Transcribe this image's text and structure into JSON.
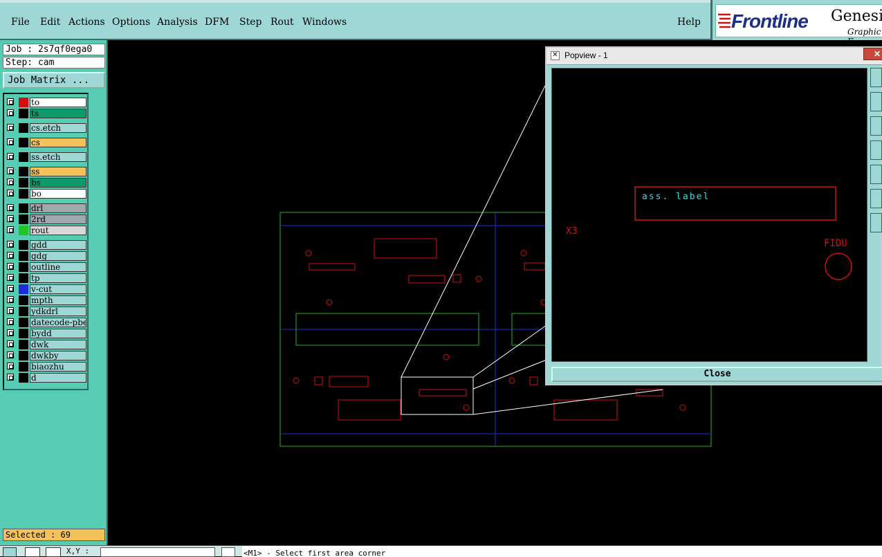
{
  "menubar": {
    "items": [
      {
        "label": "File"
      },
      {
        "label": "Edit"
      },
      {
        "label": "Actions"
      },
      {
        "label": "Options"
      },
      {
        "label": "Analysis"
      },
      {
        "label": "DFM"
      },
      {
        "label": "Step"
      },
      {
        "label": "Rout"
      },
      {
        "label": "Windows"
      }
    ],
    "help": "Help"
  },
  "brand": {
    "logo": "Frontline",
    "product": "Genesis",
    "subtitle": "Graphic E"
  },
  "job": {
    "label": "Job : 2s7qf0ega0",
    "step": "Step: cam"
  },
  "job_matrix_label": "Job Matrix ...",
  "layers": [
    {
      "name": "to",
      "color": "#ffffff",
      "swatch": "#d11010"
    },
    {
      "name": "ts",
      "color": "#0f9a6c",
      "swatch": ""
    },
    {
      "name": "cs.etch",
      "color": "#9ed7d5",
      "swatch": ""
    },
    {
      "name": "cs",
      "color": "#f5c15a",
      "swatch": ""
    },
    {
      "name": "ss.etch",
      "color": "#9ed7d5",
      "swatch": ""
    },
    {
      "name": "ss",
      "color": "#f5c15a",
      "swatch": ""
    },
    {
      "name": "bs",
      "color": "#0f9a6c",
      "swatch": ""
    },
    {
      "name": "bo",
      "color": "#ffffff",
      "swatch": ""
    },
    {
      "name": "drl",
      "color": "#9fa9ad",
      "swatch": ""
    },
    {
      "name": "2rd",
      "color": "#9fa9ad",
      "swatch": ""
    },
    {
      "name": "rout",
      "color": "#d8d8d8",
      "swatch": "#22c422"
    },
    {
      "name": "gdd",
      "color": "#9ed7d5",
      "swatch": ""
    },
    {
      "name": "gdg",
      "color": "#9ed7d5",
      "swatch": ""
    },
    {
      "name": "outline",
      "color": "#9ed7d5",
      "swatch": ""
    },
    {
      "name": "tp",
      "color": "#9ed7d5",
      "swatch": ""
    },
    {
      "name": "v-cut",
      "color": "#9ed7d5",
      "swatch": "#1f2bd6"
    },
    {
      "name": "mpth",
      "color": "#9ed7d5",
      "swatch": ""
    },
    {
      "name": "ydkdrl",
      "color": "#9ed7d5",
      "swatch": ""
    },
    {
      "name": "datecode-pbe",
      "color": "#9ed7d5",
      "swatch": ""
    },
    {
      "name": "bydd",
      "color": "#9ed7d5",
      "swatch": ""
    },
    {
      "name": "dwk",
      "color": "#9ed7d5",
      "swatch": ""
    },
    {
      "name": "dwkby",
      "color": "#9ed7d5",
      "swatch": ""
    },
    {
      "name": "biaozhu",
      "color": "#9ed7d5",
      "swatch": ""
    },
    {
      "name": "d",
      "color": "#9ed7d5",
      "swatch": ""
    }
  ],
  "selected": "Selected : 69",
  "bottombar": {
    "coord_label": "X,Y :",
    "command": "<M1> - Select first area corner"
  },
  "popview": {
    "title": "Popview - 1",
    "close_label": "Close",
    "canvas": {
      "label_text": "ass. label",
      "x3_text": "X3",
      "fidu_text": "FIDU"
    }
  },
  "colors": {
    "panel": "#56cdb3",
    "menubar": "#9ed7d5",
    "pcb_red": "#d11010",
    "pcb_green": "#27b327",
    "pcb_blue": "#1f2bd6",
    "selected_bg": "#f5c15a"
  }
}
